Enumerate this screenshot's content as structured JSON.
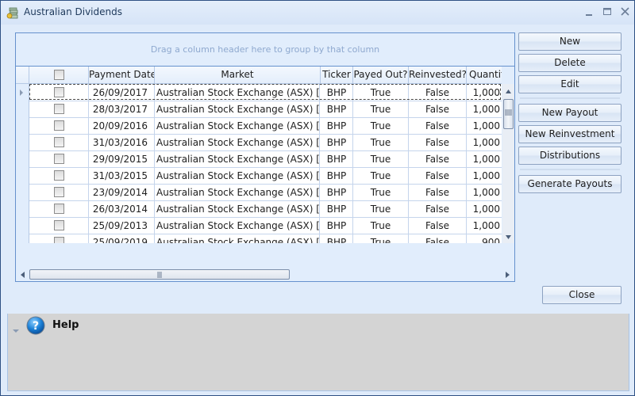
{
  "window": {
    "title": "Australian Dividends"
  },
  "grid": {
    "group_panel_hint": "Drag a column header here to group by that column",
    "columns": [
      "",
      "Payment Date",
      "Market",
      "Ticker",
      "Payed Out?",
      "Reinvested?",
      "Quantit"
    ],
    "rows": [
      {
        "date": "26/09/2017",
        "market": "Australian Stock Exchange (ASX) [AUD]",
        "ticker": "BHP",
        "payed_out": "True",
        "reinvested": "False",
        "quantity": "1,000"
      },
      {
        "date": "28/03/2017",
        "market": "Australian Stock Exchange (ASX) [AUD]",
        "ticker": "BHP",
        "payed_out": "True",
        "reinvested": "False",
        "quantity": "1,000"
      },
      {
        "date": "20/09/2016",
        "market": "Australian Stock Exchange (ASX) [AUD]",
        "ticker": "BHP",
        "payed_out": "True",
        "reinvested": "False",
        "quantity": "1,000"
      },
      {
        "date": "31/03/2016",
        "market": "Australian Stock Exchange (ASX) [AUD]",
        "ticker": "BHP",
        "payed_out": "True",
        "reinvested": "False",
        "quantity": "1,000"
      },
      {
        "date": "29/09/2015",
        "market": "Australian Stock Exchange (ASX) [AUD]",
        "ticker": "BHP",
        "payed_out": "True",
        "reinvested": "False",
        "quantity": "1,000"
      },
      {
        "date": "31/03/2015",
        "market": "Australian Stock Exchange (ASX) [AUD]",
        "ticker": "BHP",
        "payed_out": "True",
        "reinvested": "False",
        "quantity": "1,000"
      },
      {
        "date": "23/09/2014",
        "market": "Australian Stock Exchange (ASX) [AUD]",
        "ticker": "BHP",
        "payed_out": "True",
        "reinvested": "False",
        "quantity": "1,000"
      },
      {
        "date": "26/03/2014",
        "market": "Australian Stock Exchange (ASX) [AUD]",
        "ticker": "BHP",
        "payed_out": "True",
        "reinvested": "False",
        "quantity": "1,000"
      },
      {
        "date": "25/09/2013",
        "market": "Australian Stock Exchange (ASX) [AUD]",
        "ticker": "BHP",
        "payed_out": "True",
        "reinvested": "False",
        "quantity": "1,000"
      },
      {
        "date": "25/09/2019",
        "market": "Australian Stock Exchange (ASX) [AUD]",
        "ticker": "BHP",
        "payed_out": "True",
        "reinvested": "False",
        "quantity": "900"
      }
    ],
    "selected_row": 0
  },
  "actions": {
    "new": "New",
    "delete": "Delete",
    "edit": "Edit",
    "new_payout": "New Payout",
    "new_reinvestment": "New Reinvestment",
    "distributions": "Distributions",
    "generate_payouts": "Generate Payouts",
    "close": "Close"
  },
  "help": {
    "title": "Help"
  },
  "colors": {
    "window_border": "#2f5184",
    "grid_border": "#6591cd",
    "help_bg": "#d4d4d4",
    "help_icon": "#1a7fd6"
  }
}
